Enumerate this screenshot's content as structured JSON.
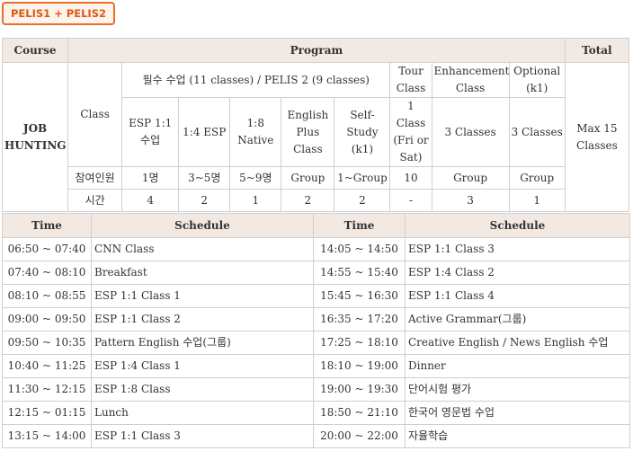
{
  "badge": "PELIS1 + PELIS2",
  "program": {
    "headers": {
      "course": "Course",
      "program": "Program",
      "total": "Total"
    },
    "course_name": "JOB HUNTING",
    "class_label": "Class",
    "required_group": "필수 수업 (11 classes) / PELIS 2 (9 classes)",
    "tour": "Tour Class",
    "enhancement": "Enhancement Class",
    "optional": "Optional (k1)",
    "sub": [
      "ESP 1:1수업",
      "1:4 ESP",
      "1:8 Native",
      "English Plus Class",
      "Self-Study (k1)",
      "1 Class (Fri or Sat)",
      "3 Classes",
      "3 Classes"
    ],
    "total": "Max 15 Classes",
    "participants": {
      "label": "참여인원",
      "values": [
        "1명",
        "3~5명",
        "5~9명",
        "Group",
        "1~Group",
        "10",
        "Group",
        "Group"
      ]
    },
    "hours": {
      "label": "시간",
      "values": [
        "4",
        "2",
        "1",
        "2",
        "2",
        "-",
        "3",
        "1"
      ]
    }
  },
  "schedule": {
    "headers": [
      "Time",
      "Schedule",
      "Time",
      "Schedule"
    ],
    "rows": [
      [
        "06:50 ~ 07:40",
        "CNN Class",
        "14:05 ~ 14:50",
        "ESP 1:1 Class 3"
      ],
      [
        "07:40 ~ 08:10",
        "Breakfast",
        "14:55 ~ 15:40",
        "ESP 1:4 Class 2"
      ],
      [
        "08:10 ~ 08:55",
        "ESP 1:1 Class 1",
        "15:45 ~ 16:30",
        "ESP 1:1 Class 4"
      ],
      [
        "09:00 ~ 09:50",
        "ESP 1:1 Class 2",
        "16:35 ~ 17:20",
        "Active Grammar(그룹)"
      ],
      [
        "09:50 ~ 10:35",
        "Pattern English 수업(그룹)",
        "17:25 ~ 18:10",
        "Creative English / News English 수업"
      ],
      [
        "10:40 ~ 11:25",
        "ESP 1:4 Class 1",
        "18:10 ~ 19:00",
        "Dinner"
      ],
      [
        "11:30 ~ 12:15",
        "ESP 1:8 Class",
        "19:00 ~ 19:30",
        "단어시험 평가"
      ],
      [
        "12:15 ~ 01:15",
        "Lunch",
        "18:50 ~ 21:10",
        "한국어 영문법 수업"
      ],
      [
        "13:15 ~ 14:00",
        "ESP 1:1 Class 3",
        "20:00 ~ 22:00",
        "자율학습"
      ]
    ]
  }
}
